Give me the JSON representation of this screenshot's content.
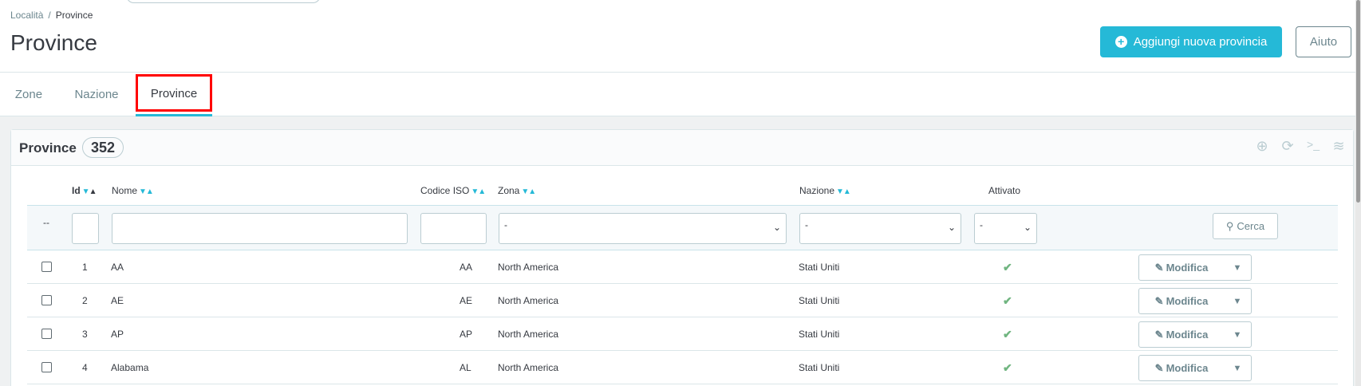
{
  "breadcrumb": {
    "parent": "Località",
    "separator": "/",
    "current": "Province"
  },
  "page": {
    "title": "Province"
  },
  "toolbar": {
    "add_label": "Aggiungi nuova provincia",
    "help_label": "Aiuto"
  },
  "tabs": [
    {
      "label": "Zone",
      "active": false
    },
    {
      "label": "Nazione",
      "active": false
    },
    {
      "label": "Province",
      "active": true
    }
  ],
  "panel": {
    "title": "Province",
    "count": "352",
    "tools": [
      "plus-circle-icon",
      "refresh-icon",
      "terminal-icon",
      "database-icon"
    ]
  },
  "table": {
    "columns": {
      "id": "Id",
      "name": "Nome",
      "iso": "Codice ISO",
      "zone": "Zona",
      "country": "Nazione",
      "active": "Attivato"
    },
    "filters": {
      "dash": "--",
      "zone_select": "-",
      "country_select": "-",
      "active_select": "-",
      "search_label": "Cerca"
    },
    "rows": [
      {
        "id": "1",
        "name": "AA",
        "iso": "AA",
        "zone": "North America",
        "country": "Stati Uniti",
        "active": true,
        "edit": "Modifica"
      },
      {
        "id": "2",
        "name": "AE",
        "iso": "AE",
        "zone": "North America",
        "country": "Stati Uniti",
        "active": true,
        "edit": "Modifica"
      },
      {
        "id": "3",
        "name": "AP",
        "iso": "AP",
        "zone": "North America",
        "country": "Stati Uniti",
        "active": true,
        "edit": "Modifica"
      },
      {
        "id": "4",
        "name": "Alabama",
        "iso": "AL",
        "zone": "North America",
        "country": "Stati Uniti",
        "active": true,
        "edit": "Modifica"
      }
    ]
  },
  "colors": {
    "accent": "#25b9d7",
    "success": "#70b580",
    "highlight": "#ff0000"
  }
}
